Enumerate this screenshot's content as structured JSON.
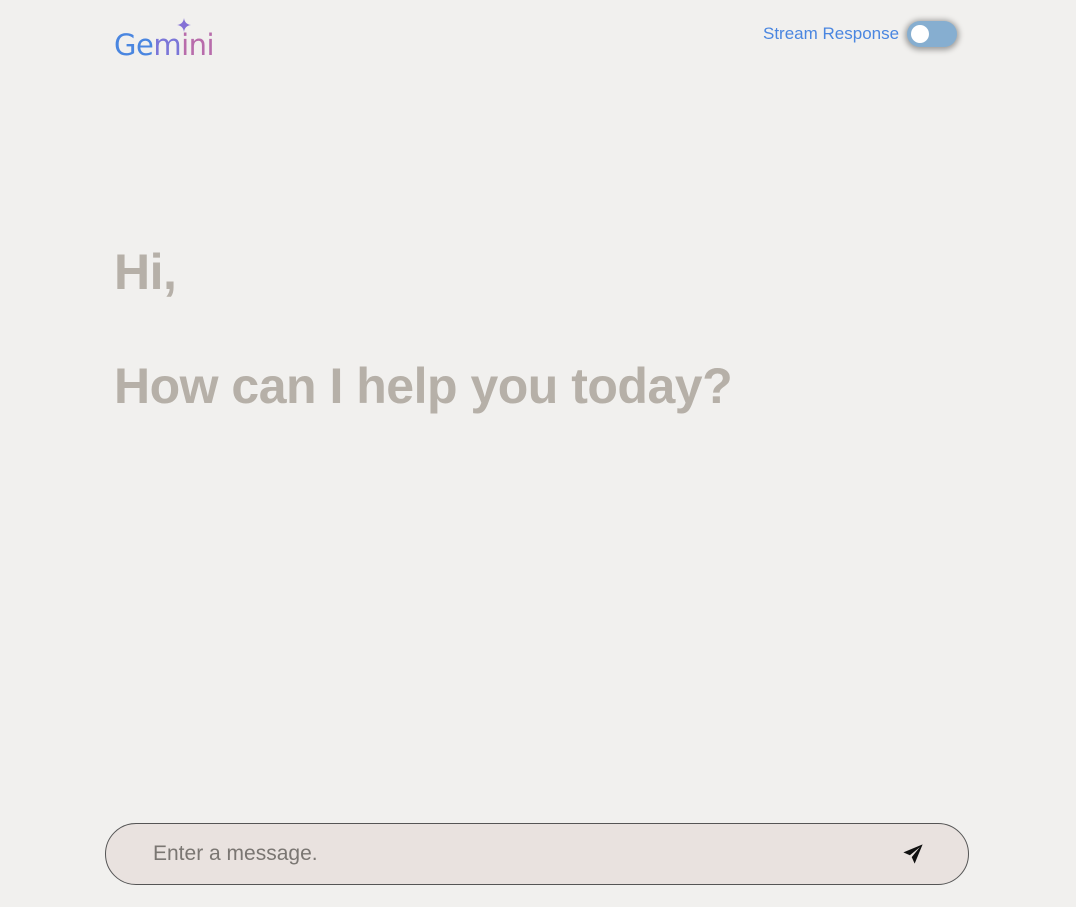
{
  "header": {
    "logo": {
      "text_part1": "Ge",
      "text_part2": "m",
      "text_part3": "ini",
      "icon": "sparkle-icon"
    },
    "stream_toggle": {
      "label": "Stream Response",
      "enabled": false
    }
  },
  "greeting": {
    "line1": "Hi,",
    "line2": "How can I help you today?"
  },
  "composer": {
    "placeholder": "Enter a message.",
    "value": "",
    "send_icon": "paper-plane-icon"
  },
  "colors": {
    "brand_blue": "#4a86e0",
    "greeting_text": "#b6b0a8",
    "background": "#f1f0ee",
    "input_background": "#e9e2df",
    "toggle_track": "#86aed0"
  }
}
